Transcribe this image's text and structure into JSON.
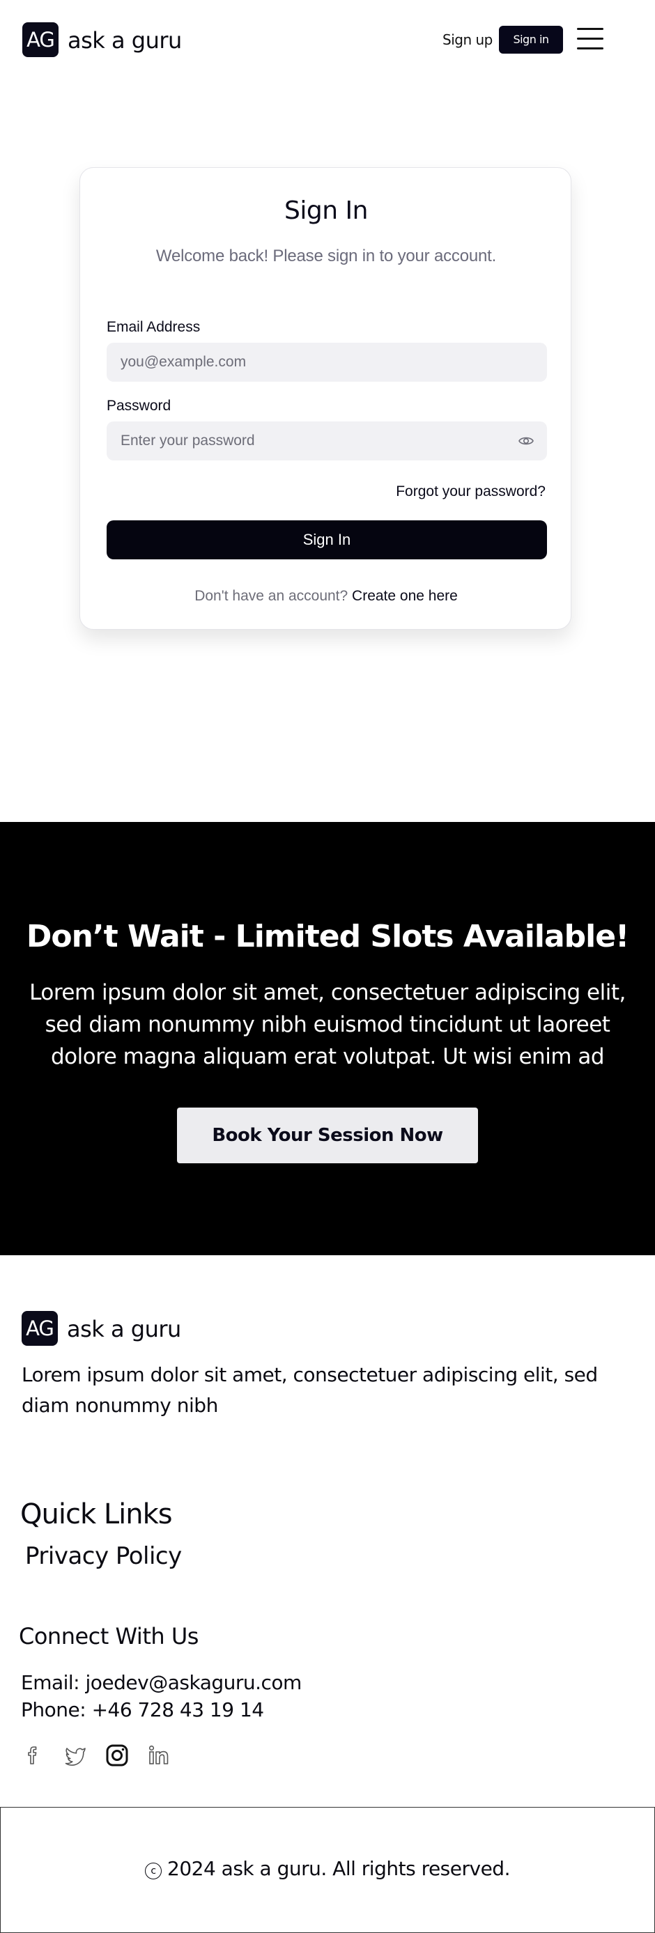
{
  "header": {
    "logo_initials": "AG",
    "brand": "ask a guru",
    "signup_label": "Sign up",
    "signin_label": "Sign in"
  },
  "signin": {
    "title": "Sign In",
    "subtitle": "Welcome back! Please sign in to your account.",
    "email_label": "Email Address",
    "email_placeholder": "you@example.com",
    "email_value": "",
    "password_label": "Password",
    "password_placeholder": "Enter your password",
    "password_value": "",
    "forgot_label": "Forgot your password?",
    "submit_label": "Sign In",
    "no_account_text": "Don't have an account?",
    "create_link": "Create one here"
  },
  "cta": {
    "title": "Don’t Wait - Limited Slots Available!",
    "text": "Lorem ipsum dolor sit amet, consectetuer adipiscing elit, sed diam nonummy nibh euismod tincidunt ut laoreet dolore magna aliquam erat volutpat. Ut wisi enim ad",
    "button_label": "Book Your Session Now"
  },
  "footer": {
    "logo_initials": "AG",
    "brand": "ask a guru",
    "description": "Lorem ipsum dolor sit amet, consectetuer adipiscing elit, sed diam nonummy nibh",
    "quick_links_title": "Quick Links",
    "quick_links": [
      "Privacy Policy"
    ],
    "connect_title": "Connect With Us",
    "email_line": "Email: joedev@askaguru.com",
    "phone_line": "Phone: +46 728 43 19 14",
    "socials": [
      "facebook-icon",
      "twitter-icon",
      "instagram-icon",
      "linkedin-icon"
    ],
    "copyright_symbol": "c",
    "copyright": "2024 ask a guru. All rights reserved."
  },
  "colors": {
    "primary_dark": "#07071a",
    "cta_background": "#000000",
    "cta_button": "#ececef",
    "input_background": "#f1f1f4",
    "muted_text": "#6b6b7b"
  }
}
